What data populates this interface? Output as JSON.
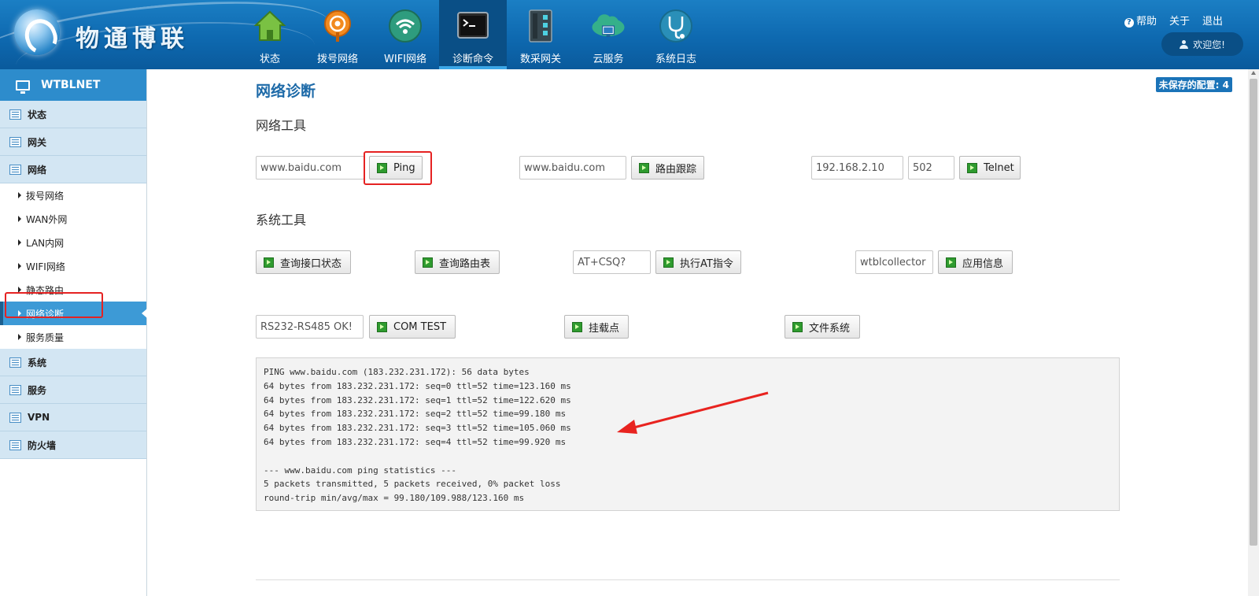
{
  "header": {
    "logo_text": "物通博联",
    "nav": [
      {
        "label": "状态",
        "icon": "house-icon",
        "active": false
      },
      {
        "label": "拨号网络",
        "icon": "dialup-antenna-icon",
        "active": false
      },
      {
        "label": "WIFI网络",
        "icon": "wifi-icon",
        "active": false
      },
      {
        "label": "诊断命令",
        "icon": "terminal-icon",
        "active": true
      },
      {
        "label": "数采网关",
        "icon": "gateway-device-icon",
        "active": false
      },
      {
        "label": "云服务",
        "icon": "cloud-icon",
        "active": false
      },
      {
        "label": "系统日志",
        "icon": "stethoscope-icon",
        "active": false
      }
    ],
    "links": {
      "help": "帮助",
      "about": "关于",
      "logout": "退出"
    },
    "welcome": "欢迎您!"
  },
  "sidebar": {
    "title": "WTBLNET",
    "groups": [
      {
        "label": "状态"
      },
      {
        "label": "网关"
      },
      {
        "label": "网络",
        "children": [
          "拨号网络",
          "WAN外网",
          "LAN内网",
          "WIFI网络",
          "静态路由",
          "网络诊断",
          "服务质量"
        ]
      },
      {
        "label": "系统"
      },
      {
        "label": "服务"
      },
      {
        "label": "VPN"
      },
      {
        "label": "防火墙"
      }
    ],
    "active_child": "网络诊断"
  },
  "main": {
    "title": "网络诊断",
    "unsaved": "未保存的配置: 4",
    "network_tools": {
      "title": "网络工具",
      "ping_host": "www.baidu.com",
      "ping_label": "Ping",
      "trace_host": "www.baidu.com",
      "trace_label": "路由跟踪",
      "telnet_host": "192.168.2.10",
      "telnet_port": "502",
      "telnet_label": "Telnet"
    },
    "system_tools": {
      "title": "系统工具",
      "iface_label": "查询接口状态",
      "route_label": "查询路由表",
      "at_cmd": "AT+CSQ?",
      "at_label": "执行AT指令",
      "app_name": "wtblcollector",
      "app_label": "应用信息",
      "com_value": "RS232-RS485 OK!",
      "com_label": "COM TEST",
      "mount_label": "挂载点",
      "fs_label": "文件系统"
    },
    "output": "PING www.baidu.com (183.232.231.172): 56 data bytes\n64 bytes from 183.232.231.172: seq=0 ttl=52 time=123.160 ms\n64 bytes from 183.232.231.172: seq=1 ttl=52 time=122.620 ms\n64 bytes from 183.232.231.172: seq=2 ttl=52 time=99.180 ms\n64 bytes from 183.232.231.172: seq=3 ttl=52 time=105.060 ms\n64 bytes from 183.232.231.172: seq=4 ttl=52 time=99.920 ms\n\n--- www.baidu.com ping statistics ---\n5 packets transmitted, 5 packets received, 0% packet loss\nround-trip min/avg/max = 99.180/109.988/123.160 ms"
  },
  "colors": {
    "header": "#0e69b0",
    "accent": "#3d9ad6",
    "highlight": "#e52222"
  }
}
